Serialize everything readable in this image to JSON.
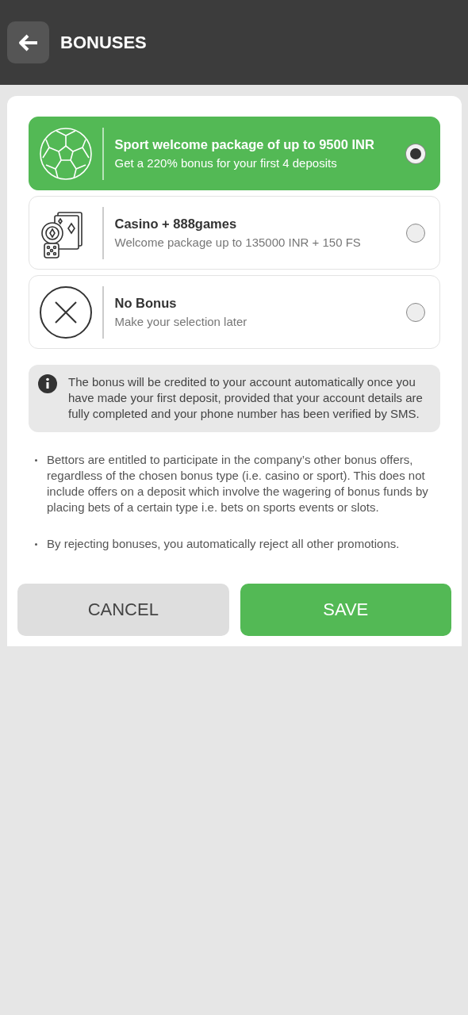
{
  "header": {
    "title": "BONUSES"
  },
  "options": [
    {
      "kind": "sport",
      "title": "Sport welcome package of up to 9500 INR",
      "subtitle": "Get a 220% bonus for your first 4 deposits",
      "selected": true
    },
    {
      "kind": "casino",
      "title": "Casino + 888games",
      "subtitle": "Welcome package up to 135000 INR + 150 FS",
      "selected": false
    },
    {
      "kind": "none",
      "title": "No Bonus",
      "subtitle": "Make your selection later",
      "selected": false
    }
  ],
  "info": "The bonus will be credited to your account automatically once you have made your first deposit, provided that your account details are fully completed and your phone number has been verified by SMS.",
  "notes": [
    "Bettors are entitled to participate in the company’s other bonus offers, regardless of the chosen bonus type (i.e. casino or sport). This does not include offers on a deposit which involve the wagering of bonus funds by placing bets of a certain type i.e. bets on sports events or slots.",
    "By rejecting bonuses, you automatically reject all other promotions."
  ],
  "buttons": [
    {
      "kind": "cancel",
      "label": "CANCEL"
    },
    {
      "kind": "save",
      "label": "SAVE"
    }
  ]
}
